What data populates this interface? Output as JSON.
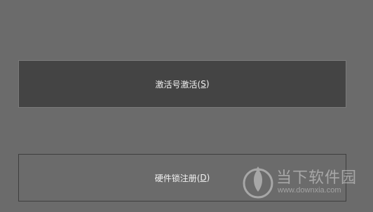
{
  "buttons": {
    "activation": {
      "label": "激活号激活(",
      "accel": "S",
      "close": ")"
    },
    "hardware_lock": {
      "label": "硬件锁注册(",
      "accel": "D",
      "close": ")"
    }
  },
  "watermark": {
    "title": "当下软件园",
    "url": "www.downxia.com"
  }
}
